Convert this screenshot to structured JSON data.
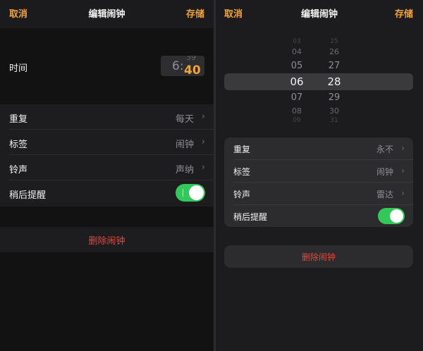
{
  "left": {
    "cancel": "取消",
    "title": "编辑闹钟",
    "save": "存储",
    "time_label": "时间",
    "time_hour": "6:",
    "time_minute_prev": "39",
    "time_minute": "40",
    "rows": [
      {
        "label": "重复",
        "value": "每天",
        "chevron": "›"
      },
      {
        "label": "标签",
        "value": "闹钟",
        "chevron": "›"
      },
      {
        "label": "铃声",
        "value": "声纳",
        "chevron": "›"
      }
    ],
    "snooze_label": "稍后提醒",
    "snooze_on": true,
    "delete": "删除闹钟"
  },
  "right": {
    "cancel": "取消",
    "title": "编辑闹钟",
    "save": "存储",
    "picker_hours": [
      "03",
      "04",
      "05",
      "06",
      "07",
      "08",
      "09"
    ],
    "picker_minutes": [
      "25",
      "26",
      "27",
      "28",
      "29",
      "30",
      "31"
    ],
    "selected_hour": "06",
    "selected_minute": "28",
    "rows": [
      {
        "label": "重复",
        "value": "永不",
        "chevron": "›"
      },
      {
        "label": "标签",
        "value": "闹钟",
        "chevron": "›"
      },
      {
        "label": "铃声",
        "value": "雷达",
        "chevron": "›"
      }
    ],
    "snooze_label": "稍后提醒",
    "snooze_on": true,
    "delete": "删除闹钟"
  },
  "colors": {
    "accent": "#f2a33a",
    "toggle_on": "#34c759",
    "destructive": "#e5463d"
  }
}
